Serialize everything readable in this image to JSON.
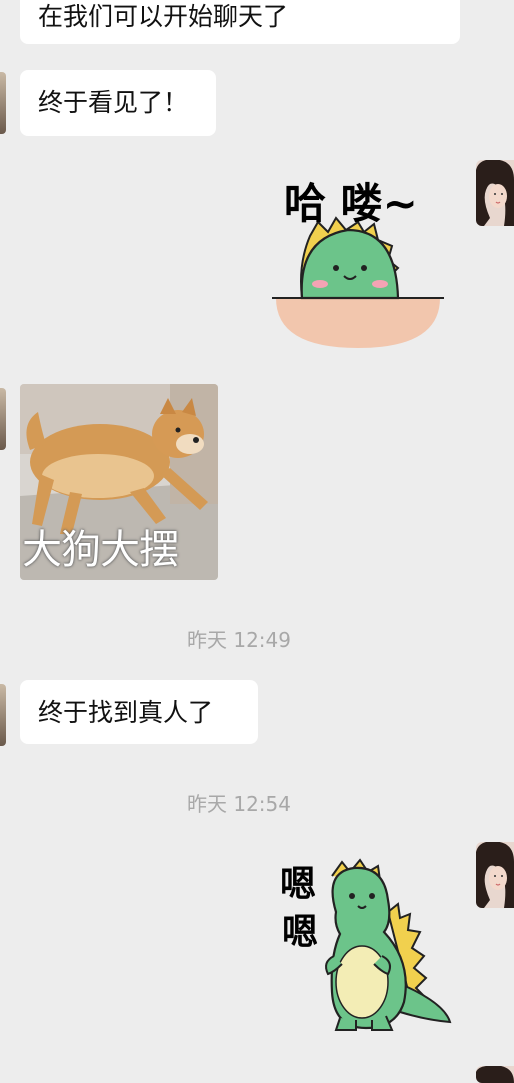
{
  "messages": {
    "m1": "在我们可以开始聊天了",
    "m2": "终于看见了！",
    "m3": "终于找到真人了"
  },
  "stickers": {
    "hello_text": "哈 喽~",
    "dog_caption": "大狗大摆",
    "enen_text_1": "嗯",
    "enen_text_2": "嗯"
  },
  "timestamps": {
    "t1": "昨天 12:49",
    "t2": "昨天 12:54"
  },
  "colors": {
    "background": "#ededed",
    "bubble": "#ffffff",
    "dino_green": "#6cc48a",
    "timestamp_gray": "#a8a8a8"
  }
}
